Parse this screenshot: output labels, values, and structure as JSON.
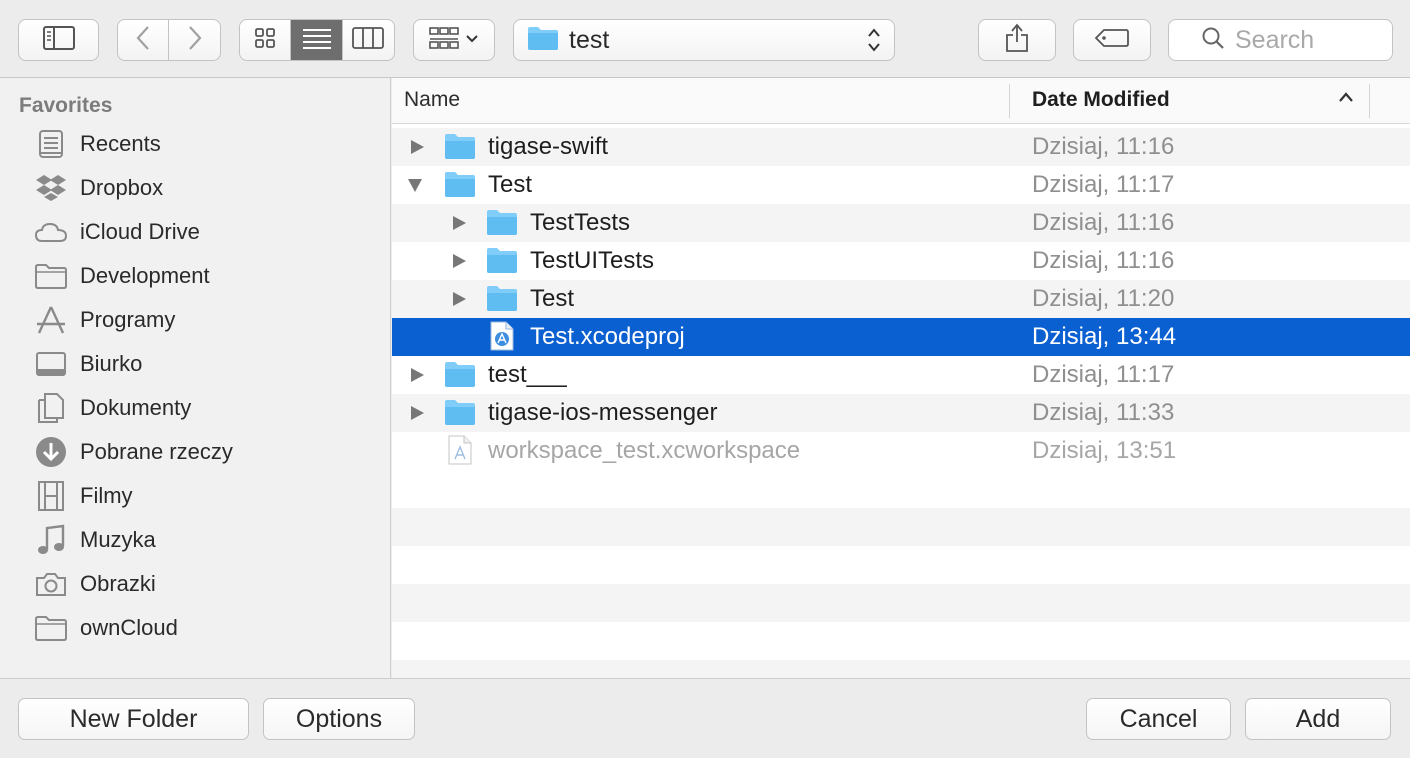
{
  "toolbar": {
    "path_label": "test",
    "search_placeholder": "Search"
  },
  "sidebar": {
    "section_title": "Favorites",
    "items": [
      {
        "label": "Recents"
      },
      {
        "label": "Dropbox"
      },
      {
        "label": "iCloud Drive"
      },
      {
        "label": "Development"
      },
      {
        "label": "Programy"
      },
      {
        "label": "Biurko"
      },
      {
        "label": "Dokumenty"
      },
      {
        "label": "Pobrane rzeczy"
      },
      {
        "label": "Filmy"
      },
      {
        "label": "Muzyka"
      },
      {
        "label": "Obrazki"
      },
      {
        "label": "ownCloud"
      }
    ]
  },
  "list": {
    "columns": {
      "name": "Name",
      "date": "Date Modified"
    },
    "rows": [
      {
        "name": "tigase-swift",
        "date": "Dzisiaj, 11:16",
        "type": "folder",
        "state": "collapsed"
      },
      {
        "name": "Test",
        "date": "Dzisiaj, 11:17",
        "type": "folder",
        "state": "expanded"
      },
      {
        "name": "TestTests",
        "date": "Dzisiaj, 11:16",
        "type": "folder",
        "state": "collapsed"
      },
      {
        "name": "TestUITests",
        "date": "Dzisiaj, 11:16",
        "type": "folder",
        "state": "collapsed"
      },
      {
        "name": "Test",
        "date": "Dzisiaj, 11:20",
        "type": "folder",
        "state": "collapsed"
      },
      {
        "name": "Test.xcodeproj",
        "date": "Dzisiaj, 13:44",
        "type": "xcode-project",
        "state": "selected"
      },
      {
        "name": "test___",
        "date": "Dzisiaj, 11:17",
        "type": "folder",
        "state": "collapsed"
      },
      {
        "name": "tigase-ios-messenger",
        "date": "Dzisiaj, 11:33",
        "type": "folder",
        "state": "collapsed"
      },
      {
        "name": "workspace_test.xcworkspace",
        "date": "Dzisiaj, 13:51",
        "type": "xcode-workspace",
        "state": "disabled"
      }
    ]
  },
  "bottom": {
    "new_folder": "New Folder",
    "options": "Options",
    "cancel": "Cancel",
    "add": "Add"
  },
  "colors": {
    "selection": "#0b60d1",
    "folder": "#6bc4f5"
  }
}
